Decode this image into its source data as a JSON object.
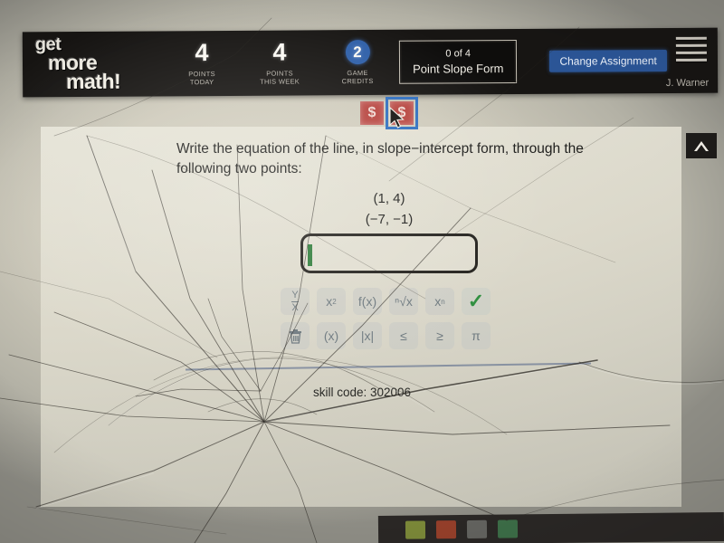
{
  "app": {
    "logo_line1": "get",
    "logo_line2": "more",
    "logo_line3": "math!",
    "user_name": "J. Warner"
  },
  "header": {
    "stats": [
      {
        "value": "4",
        "label_line1": "POINTS",
        "label_line2": "TODAY",
        "circled": false
      },
      {
        "value": "4",
        "label_line1": "POINTS",
        "label_line2": "THIS WEEK",
        "circled": false
      },
      {
        "value": "2",
        "label_line1": "GAME",
        "label_line2": "CREDITS",
        "circled": true
      }
    ],
    "assignment_progress": "0 of 4",
    "assignment_name": "Point Slope Form",
    "change_assignment_label": "Change Assignment",
    "menu_icon": "hamburger-menu-icon",
    "accent_blue": "#2b5596",
    "credit_badge_blue": "#2e5fa8"
  },
  "reward_tiles": [
    {
      "icon": "dollar-sign-icon",
      "label": "$",
      "selected": false
    },
    {
      "icon": "dollar-sign-icon",
      "label": "$",
      "selected": true
    }
  ],
  "question": {
    "prompt": "Write the equation of the line, in slope−intercept form, through the following two points:",
    "point_1": "(1, 4)",
    "point_2": "(−7, −1)"
  },
  "answer": {
    "value": "",
    "placeholder": ""
  },
  "math_toolbar": {
    "row1": [
      {
        "name": "fraction-button",
        "numerator": "Y",
        "denominator": "X"
      },
      {
        "name": "square-power-button",
        "label": "x",
        "sup": "2"
      },
      {
        "name": "function-button",
        "label": "f(x)"
      },
      {
        "name": "nth-root-button",
        "label": "ⁿ√x"
      },
      {
        "name": "subscript-button",
        "label": "x",
        "sub": "n"
      },
      {
        "name": "submit-check-button",
        "label": "✓",
        "color": "#2f8f3f"
      }
    ],
    "row2": [
      {
        "name": "delete-trash-button",
        "label": "🗑"
      },
      {
        "name": "parentheses-button",
        "label": "(x)"
      },
      {
        "name": "absolute-value-button",
        "label": "|x|"
      },
      {
        "name": "less-than-equal-button",
        "label": "≤"
      },
      {
        "name": "greater-than-equal-button",
        "label": "≥"
      },
      {
        "name": "pi-button",
        "label": "π"
      }
    ]
  },
  "footer": {
    "skill_code": "skill code: 302006"
  },
  "collapse_control": {
    "icon": "chevron-up-icon"
  },
  "taskbar": {
    "icons": [
      {
        "name": "taskbar-icon-green",
        "color": "#8a9a3c"
      },
      {
        "name": "taskbar-icon-red",
        "color": "#a8442c"
      },
      {
        "name": "taskbar-icon-gray",
        "color": "#6d6f6a"
      },
      {
        "name": "taskbar-icon-excel",
        "color": "#3f7a4e"
      }
    ]
  }
}
